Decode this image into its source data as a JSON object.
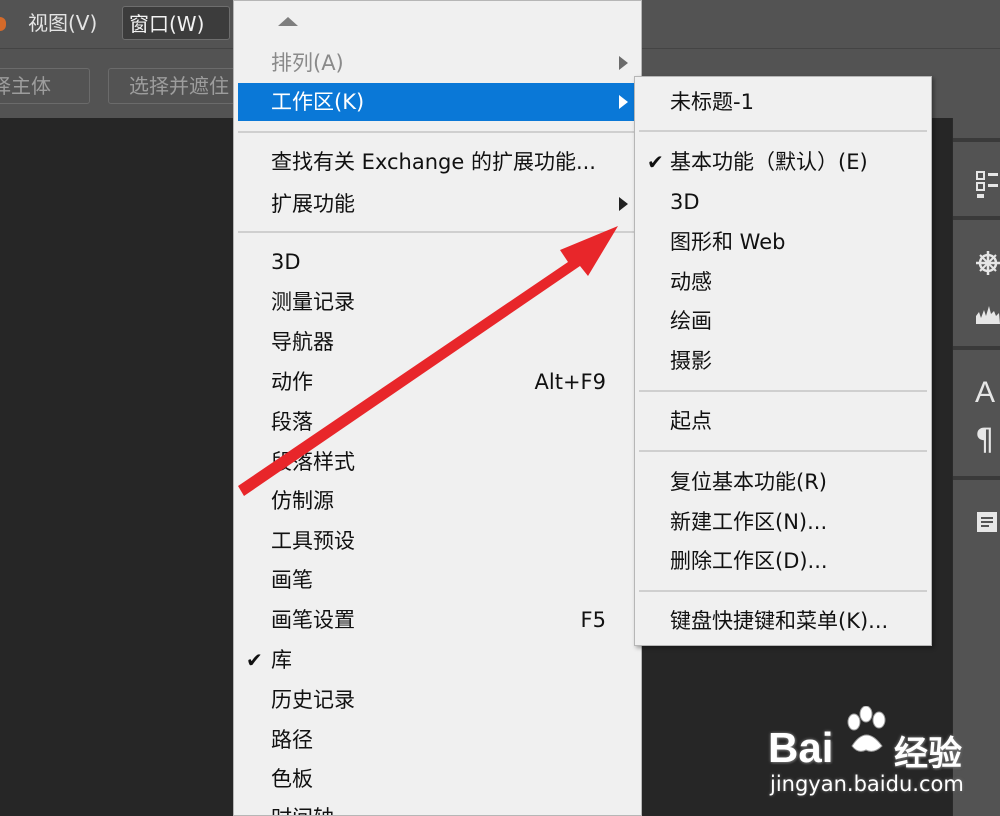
{
  "menubar": {
    "view": "视图(V)",
    "window": "窗口(W)"
  },
  "options": {
    "select_subject": "择主体",
    "select_and_mask": "选择并遮住"
  },
  "window_menu": {
    "items": [
      {
        "label": "排列(A)",
        "disabled": true,
        "submenu": true
      },
      {
        "label": "工作区(K)",
        "highlighted": true,
        "submenu": true
      },
      {
        "label": "查找有关 Exchange 的扩展功能..."
      },
      {
        "label": "扩展功能",
        "submenu": true
      },
      {
        "label": "3D"
      },
      {
        "label": "测量记录"
      },
      {
        "label": "导航器"
      },
      {
        "label": "动作",
        "shortcut": "Alt+F9"
      },
      {
        "label": "段落"
      },
      {
        "label": "段落样式"
      },
      {
        "label": "仿制源"
      },
      {
        "label": "工具预设"
      },
      {
        "label": "画笔"
      },
      {
        "label": "画笔设置",
        "shortcut": "F5"
      },
      {
        "label": "库",
        "checked": true
      },
      {
        "label": "历史记录"
      },
      {
        "label": "路径"
      },
      {
        "label": "色板"
      },
      {
        "label": "时间轴"
      }
    ]
  },
  "workspace_submenu": {
    "items": [
      {
        "label": "未标题-1"
      },
      {
        "label": "基本功能（默认）(E)",
        "checked": true
      },
      {
        "label": "3D"
      },
      {
        "label": "图形和 Web"
      },
      {
        "label": "动感"
      },
      {
        "label": "绘画"
      },
      {
        "label": "摄影"
      },
      {
        "label": "起点"
      },
      {
        "label": "复位基本功能(R)"
      },
      {
        "label": "新建工作区(N)..."
      },
      {
        "label": "删除工作区(D)..."
      },
      {
        "label": "键盘快捷键和菜单(K)..."
      }
    ]
  },
  "check_glyph": "✔",
  "watermark": {
    "logo": "Bai",
    "brand": "经验",
    "url": "jingyan.baidu.com"
  },
  "annotation_color": "#e8262a",
  "highlight_color": "#0a78d7"
}
